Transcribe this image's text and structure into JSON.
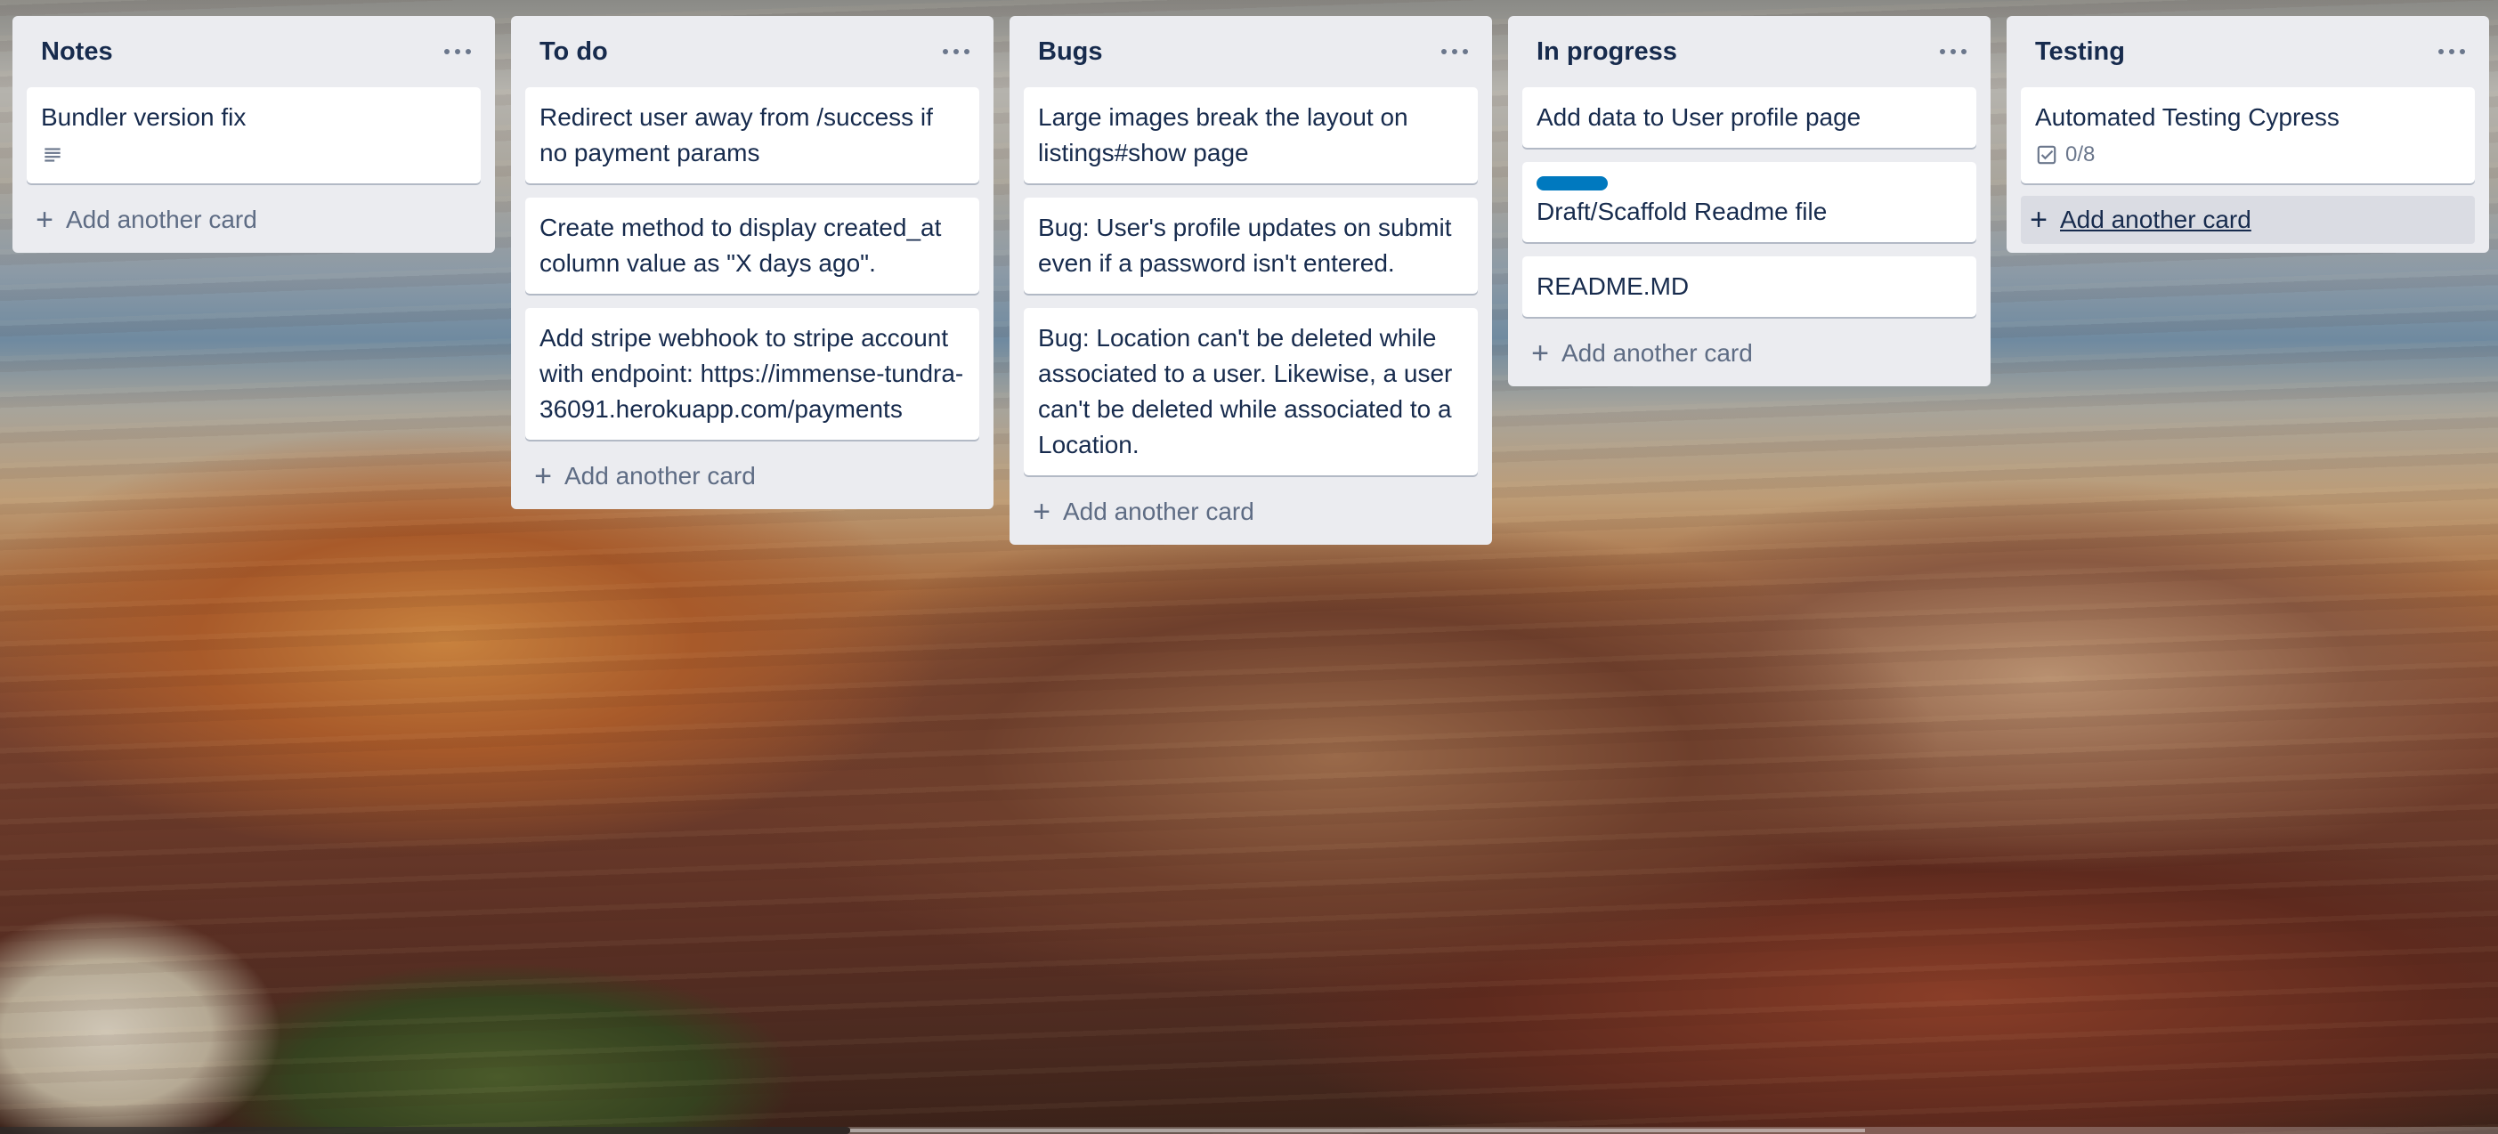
{
  "board": {
    "lists": [
      {
        "title": "Notes",
        "cards": [
          {
            "text": "Bundler version fix",
            "has_description": true
          }
        ],
        "add_label": "Add another card"
      },
      {
        "title": "To do",
        "cards": [
          {
            "text": "Redirect user away from /success if no payment params"
          },
          {
            "text": "Create method to display created_at column value as \"X days ago\"."
          },
          {
            "text": "Add stripe webhook to stripe account with endpoint: https://immense-tundra-36091.herokuapp.com/payments"
          }
        ],
        "add_label": "Add another card"
      },
      {
        "title": "Bugs",
        "cards": [
          {
            "text": "Large images break the layout on listings#show page"
          },
          {
            "text": "Bug: User's profile updates on submit even if a password isn't entered."
          },
          {
            "text": "Bug: Location can't be deleted while associated to a user. Likewise, a user can't be deleted while associated to a Location."
          }
        ],
        "add_label": "Add another card"
      },
      {
        "title": "In progress",
        "cards": [
          {
            "text": "Add data to User profile page"
          },
          {
            "text": "Draft/Scaffold Readme file",
            "label_color": "#0079bf"
          },
          {
            "text": "README.MD"
          }
        ],
        "add_label": "Add another card"
      },
      {
        "title": "Testing",
        "cards": [
          {
            "text": "Automated Testing Cypress",
            "checklist": "0/8"
          }
        ],
        "add_label": "Add another card"
      }
    ]
  },
  "icons": {
    "list_menu": "ellipsis-icon",
    "description": "description-icon",
    "checklist": "checklist-icon",
    "add": "plus-icon"
  },
  "colors": {
    "list_bg": "#ebecf0",
    "card_bg": "#ffffff",
    "text": "#172b4d",
    "muted": "#5e6c84",
    "label_blue": "#0079bf"
  }
}
